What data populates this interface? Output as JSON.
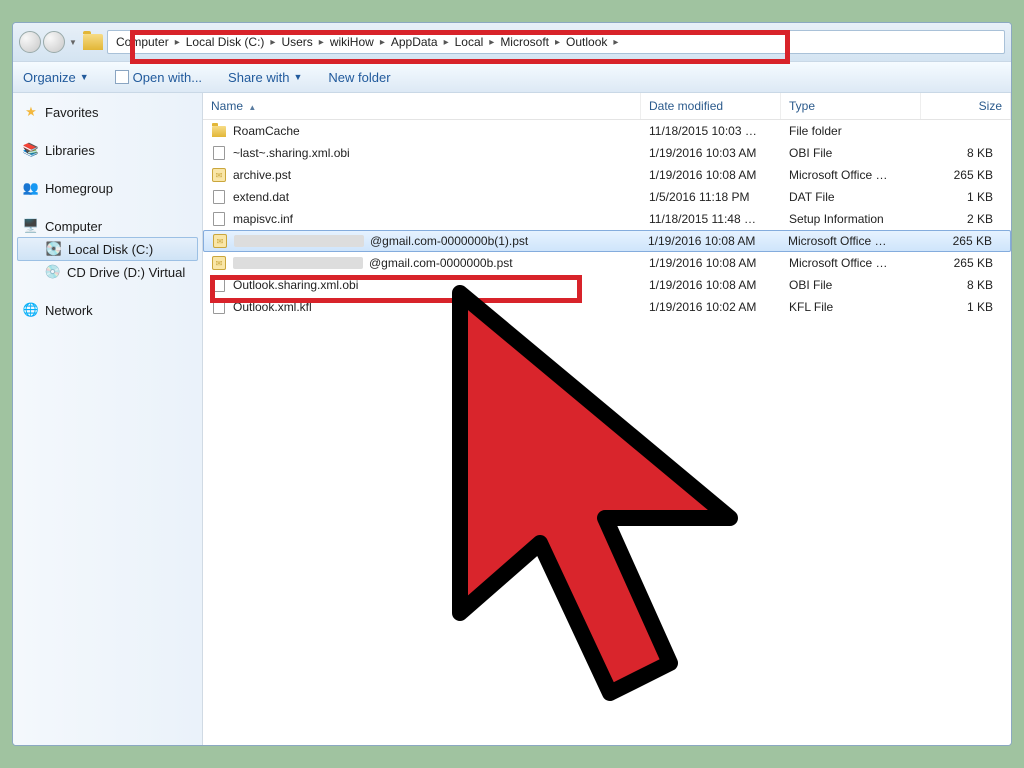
{
  "breadcrumb": [
    "Computer",
    "Local Disk (C:)",
    "Users",
    "wikiHow",
    "AppData",
    "Local",
    "Microsoft",
    "Outlook"
  ],
  "toolbar": {
    "organize": "Organize",
    "open_with": "Open with...",
    "share_with": "Share with",
    "new_folder": "New folder"
  },
  "sidebar": {
    "favorites": "Favorites",
    "libraries": "Libraries",
    "homegroup": "Homegroup",
    "computer": "Computer",
    "local_disk": "Local Disk (C:)",
    "cd_drive": "CD Drive (D:) Virtual",
    "network": "Network"
  },
  "columns": {
    "name": "Name",
    "date": "Date modified",
    "type": "Type",
    "size": "Size"
  },
  "files": [
    {
      "name": "RoamCache",
      "date": "11/18/2015 10:03 …",
      "type": "File folder",
      "size": "",
      "icon": "folder"
    },
    {
      "name": "~last~.sharing.xml.obi",
      "date": "1/19/2016 10:03 AM",
      "type": "OBI File",
      "size": "8 KB",
      "icon": "file"
    },
    {
      "name": "archive.pst",
      "date": "1/19/2016 10:08 AM",
      "type": "Microsoft Office …",
      "size": "265 KB",
      "icon": "pst"
    },
    {
      "name": "extend.dat",
      "date": "1/5/2016 11:18 PM",
      "type": "DAT File",
      "size": "1 KB",
      "icon": "file"
    },
    {
      "name": "mapisvc.inf",
      "date": "11/18/2015 11:48 …",
      "type": "Setup Information",
      "size": "2 KB",
      "icon": "file"
    },
    {
      "name": "@gmail.com-0000000b(1).pst",
      "date": "1/19/2016 10:08 AM",
      "type": "Microsoft Office …",
      "size": "265 KB",
      "icon": "pst",
      "selected": true,
      "redact_prefix": 130
    },
    {
      "name": "@gmail.com-0000000b.pst",
      "date": "1/19/2016 10:08 AM",
      "type": "Microsoft Office …",
      "size": "265 KB",
      "icon": "pst",
      "redact_prefix": 130
    },
    {
      "name": "Outlook.sharing.xml.obi",
      "date": "1/19/2016 10:08 AM",
      "type": "OBI File",
      "size": "8 KB",
      "icon": "file"
    },
    {
      "name": "Outlook.xml.kfl",
      "date": "1/19/2016 10:02 AM",
      "type": "KFL File",
      "size": "1 KB",
      "icon": "file"
    }
  ]
}
